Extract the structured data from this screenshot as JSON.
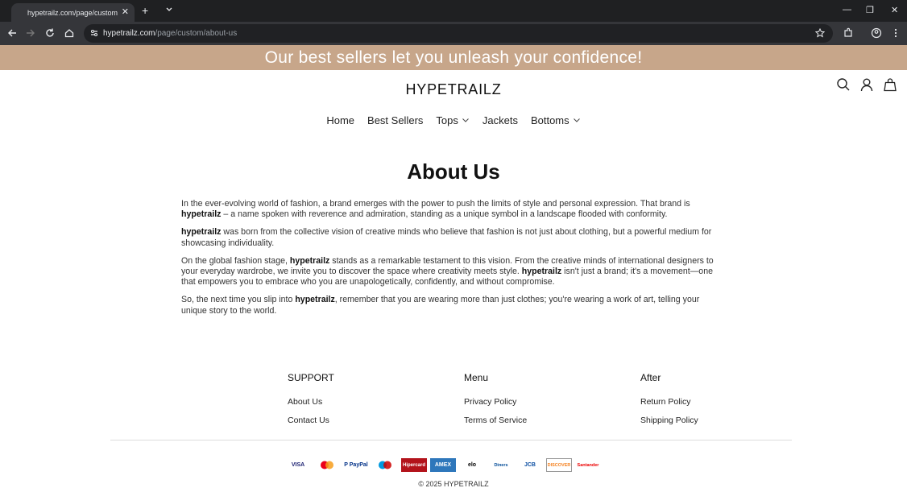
{
  "browser": {
    "tab_title": "hypetrailz.com/page/custom/about-us",
    "tab_close": "✕",
    "new_tab": "+",
    "url_host": "hypetrailz.com",
    "url_path": "/page/custom/about-us",
    "minimize": "—",
    "restore": "❐",
    "close": "✕"
  },
  "announcement": "Our best sellers let you unleash your confidence!",
  "header": {
    "logo": "HYPETRAILZ"
  },
  "nav": [
    {
      "label": "Home"
    },
    {
      "label": "Best Sellers"
    },
    {
      "label": "Tops"
    },
    {
      "label": "Jackets"
    },
    {
      "label": "Bottoms"
    }
  ],
  "page": {
    "title": "About Us",
    "brand": "hypetrailz",
    "p1_a": "In the ever-evolving world of fashion, a brand emerges with the power to push the limits of style and personal expression. That brand is ",
    "p1_b": " – a name spoken with reverence and admiration, standing as a unique symbol in a landscape flooded with conformity.",
    "p2_b": " was born from the collective vision of creative minds who believe that fashion is not just about clothing, but a powerful medium for showcasing individuality.",
    "p3_a": "On the global fashion stage, ",
    "p3_b": " stands as a remarkable testament to this vision. From the creative minds of international designers to your everyday wardrobe, we invite you to discover the space where creativity meets style. ",
    "p3_c": " isn't just a brand; it's a movement—one that empowers you to embrace who you are unapologetically, confidently, and without compromise.",
    "p4_a": "So, the next time you slip into ",
    "p4_b": ", remember that you are wearing more than just clothes; you're wearing a work of art, telling your unique story to the world."
  },
  "footer": {
    "columns": [
      {
        "title": "SUPPORT",
        "links": [
          "About Us",
          "Contact Us"
        ]
      },
      {
        "title": "Menu",
        "links": [
          "Privacy Policy",
          "Terms of Service"
        ]
      },
      {
        "title": "After",
        "links": [
          "Return Policy",
          "Shipping Policy"
        ]
      }
    ],
    "payments": [
      {
        "label": "VISA",
        "color": "#1a1f71"
      },
      {
        "label": "",
        "color": "#eb001b"
      },
      {
        "label": "P PayPal",
        "color": "#003087"
      },
      {
        "label": "",
        "color": "#0099df"
      },
      {
        "label": "Hipercard",
        "color": "#b3131b"
      },
      {
        "label": "AMEX",
        "color": "#2e77bb"
      },
      {
        "label": "elo",
        "color": "#000000"
      },
      {
        "label": "Diners",
        "color": "#004a97"
      },
      {
        "label": "JCB",
        "color": "#0b4ea2"
      },
      {
        "label": "DISCOVER",
        "color": "#f58220"
      },
      {
        "label": "Santander",
        "color": "#ec0000"
      }
    ],
    "copyright": "© 2025 HYPETRAILZ"
  },
  "colors": {
    "announcement_bg": "#c7a68a",
    "chrome_dark": "#1f2022",
    "chrome_toolbar": "#35363a"
  }
}
